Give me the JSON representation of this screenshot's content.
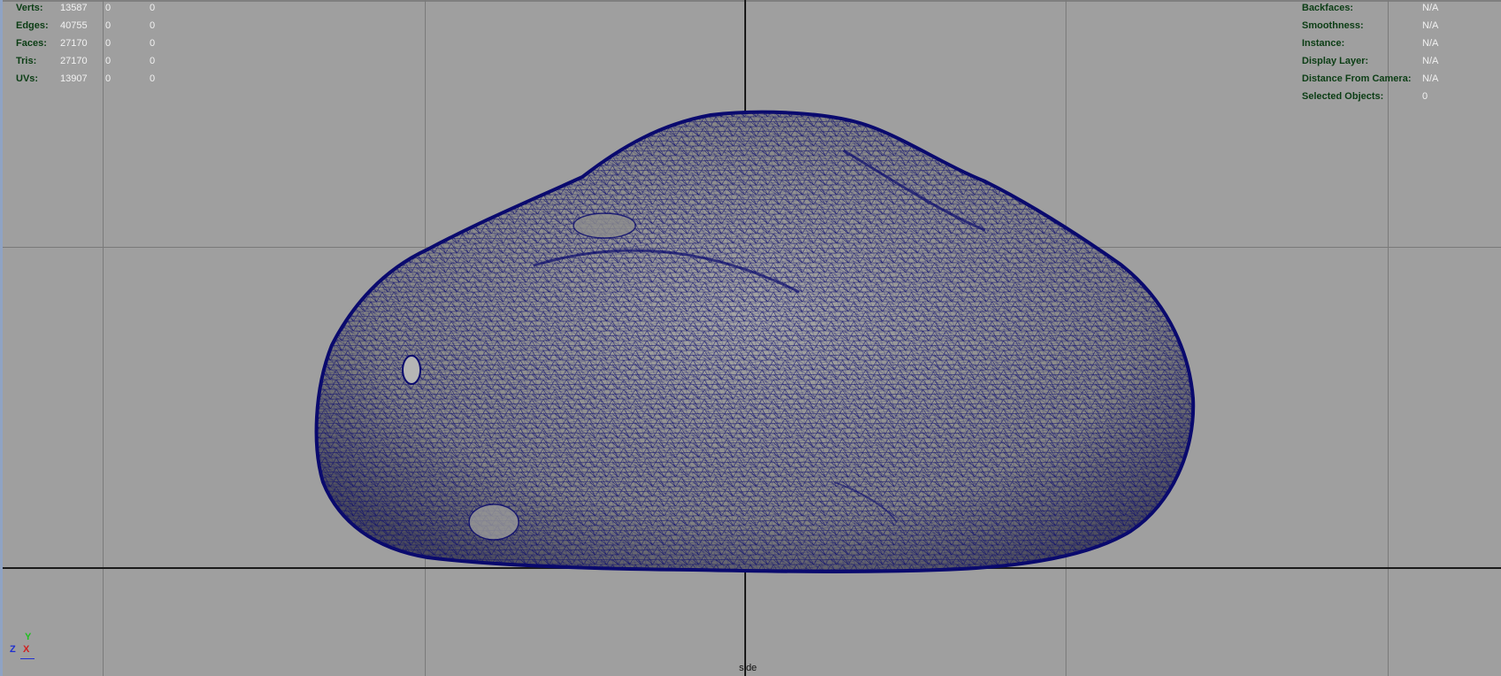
{
  "hud_left": {
    "rows": [
      {
        "label": "Verts:",
        "v1": "13587",
        "v2": "0",
        "v3": "0"
      },
      {
        "label": "Edges:",
        "v1": "40755",
        "v2": "0",
        "v3": "0"
      },
      {
        "label": "Faces:",
        "v1": "27170",
        "v2": "0",
        "v3": "0"
      },
      {
        "label": "Tris:",
        "v1": "27170",
        "v2": "0",
        "v3": "0"
      },
      {
        "label": "UVs:",
        "v1": "13907",
        "v2": "0",
        "v3": "0"
      }
    ]
  },
  "hud_right": {
    "rows": [
      {
        "label": "Backfaces:",
        "value": "N/A"
      },
      {
        "label": "Smoothness:",
        "value": "N/A"
      },
      {
        "label": "Instance:",
        "value": "N/A"
      },
      {
        "label": "Display Layer:",
        "value": "N/A"
      },
      {
        "label": "Distance From Camera:",
        "value": "N/A"
      },
      {
        "label": "Selected Objects:",
        "value": "0"
      }
    ]
  },
  "viewport": {
    "camera_name": "side",
    "background_color": "#9f9f9f",
    "wireframe_color": "#0a0a6e",
    "surface_color": "#8a8a8a"
  },
  "axis_gizmo": {
    "y_label": "Y",
    "z_label": "Z",
    "x_label": "X",
    "y_color": "#1fbf1f",
    "z_color": "#1f2fd0",
    "x_color": "#d02020"
  }
}
